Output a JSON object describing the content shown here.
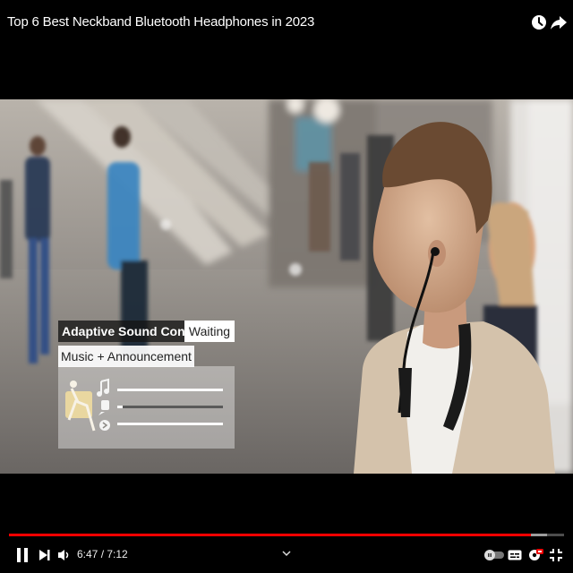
{
  "header": {
    "title": "Top 6 Best Neckband Bluetooth Headphones in 2023",
    "icons": [
      "watch-later-icon",
      "share-icon"
    ]
  },
  "overlay": {
    "feature_label": "Adaptive Sound Control",
    "mode_label": "Waiting",
    "music_label": "Music + Announcement",
    "sliders": [
      {
        "name": "music",
        "level": 1.0
      },
      {
        "name": "voice",
        "level": 0.05
      },
      {
        "name": "ambient",
        "level": 1.0
      }
    ]
  },
  "player": {
    "current_time": "6:47",
    "duration": "7:12",
    "time_display": "6:47 / 7:12",
    "played_fraction": 0.94,
    "loaded_fraction": 0.97,
    "accent_color": "#ff0000",
    "controls": [
      "play-pause",
      "next",
      "volume",
      "chapter-chevron",
      "autoplay-toggle",
      "subtitles",
      "settings",
      "fullscreen"
    ]
  }
}
